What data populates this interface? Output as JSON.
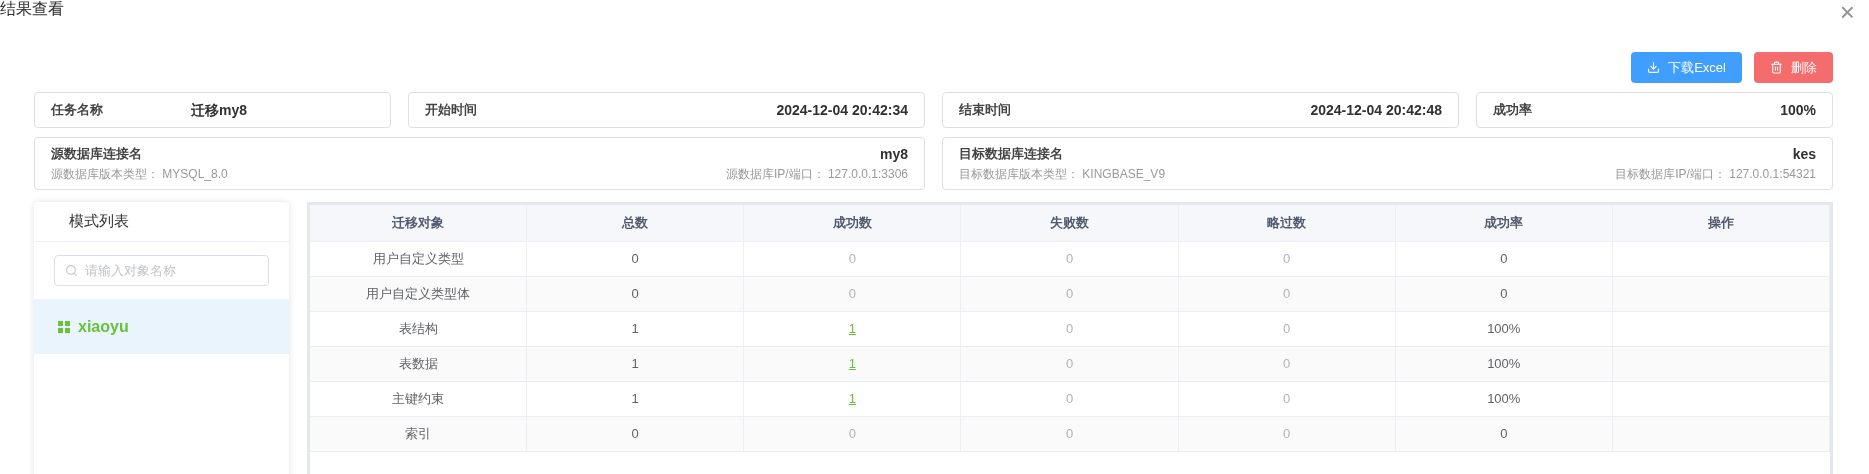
{
  "window": {
    "title": "结果查看",
    "close": "×"
  },
  "actions": [
    {
      "kind": "primary",
      "label": "下载Excel"
    },
    {
      "kind": "danger",
      "label": "删除"
    }
  ],
  "summary": [
    {
      "label": "任务名称",
      "value": "迁移my8",
      "kind": "inline"
    },
    {
      "label": "开始时间",
      "value": "2024-12-04 20:42:34",
      "kind": "split"
    },
    {
      "label": "结束时间",
      "value": "2024-12-04 20:42:48",
      "kind": "split"
    },
    {
      "label": "成功率",
      "value": "100%",
      "kind": "split"
    }
  ],
  "connections": [
    {
      "label": "源数据库连接名",
      "name": "my8",
      "version_label": "源数据库版本类型：",
      "version": "MYSQL_8.0",
      "address_label": "源数据库IP/端口：",
      "address": "127.0.0.1:3306"
    },
    {
      "label": "目标数据库连接名",
      "name": "kes",
      "version_label": "目标数据库版本类型：",
      "version": "KINGBASE_V9",
      "address_label": "目标数据库IP/端口：",
      "address": "127.0.0.1:54321"
    }
  ],
  "sidebar": {
    "title": "模式列表",
    "search": {
      "placeholder": "请输入对象名称"
    },
    "items": [
      {
        "label": "xiaoyu",
        "selected": true
      }
    ]
  },
  "table": {
    "columns": [
      "迁移对象",
      "总数",
      "成功数",
      "失败数",
      "略过数",
      "成功率",
      "操作"
    ],
    "rows": [
      {
        "cells": [
          {
            "text": "用户自定义类型",
            "kind": "plain"
          },
          {
            "text": "0",
            "kind": "plain"
          },
          {
            "text": "0",
            "kind": "muted"
          },
          {
            "text": "0",
            "kind": "muted"
          },
          {
            "text": "0",
            "kind": "muted"
          },
          {
            "text": "0",
            "kind": "plain"
          }
        ]
      },
      {
        "cells": [
          {
            "text": "用户自定义类型体",
            "kind": "plain"
          },
          {
            "text": "0",
            "kind": "plain"
          },
          {
            "text": "0",
            "kind": "muted"
          },
          {
            "text": "0",
            "kind": "muted"
          },
          {
            "text": "0",
            "kind": "muted"
          },
          {
            "text": "0",
            "kind": "plain"
          }
        ]
      },
      {
        "cells": [
          {
            "text": "表结构",
            "kind": "plain"
          },
          {
            "text": "1",
            "kind": "plain"
          },
          {
            "text": "1",
            "kind": "link"
          },
          {
            "text": "0",
            "kind": "muted"
          },
          {
            "text": "0",
            "kind": "muted"
          },
          {
            "text": "100%",
            "kind": "plain"
          }
        ]
      },
      {
        "cells": [
          {
            "text": "表数据",
            "kind": "plain"
          },
          {
            "text": "1",
            "kind": "plain"
          },
          {
            "text": "1",
            "kind": "link"
          },
          {
            "text": "0",
            "kind": "muted"
          },
          {
            "text": "0",
            "kind": "muted"
          },
          {
            "text": "100%",
            "kind": "plain"
          }
        ]
      },
      {
        "cells": [
          {
            "text": "主键约束",
            "kind": "plain"
          },
          {
            "text": "1",
            "kind": "plain"
          },
          {
            "text": "1",
            "kind": "link"
          },
          {
            "text": "0",
            "kind": "muted"
          },
          {
            "text": "0",
            "kind": "muted"
          },
          {
            "text": "100%",
            "kind": "plain"
          }
        ]
      },
      {
        "cells": [
          {
            "text": "索引",
            "kind": "plain"
          },
          {
            "text": "0",
            "kind": "plain"
          },
          {
            "text": "0",
            "kind": "muted"
          },
          {
            "text": "0",
            "kind": "muted"
          },
          {
            "text": "0",
            "kind": "muted"
          },
          {
            "text": "0",
            "kind": "plain"
          }
        ]
      }
    ]
  }
}
